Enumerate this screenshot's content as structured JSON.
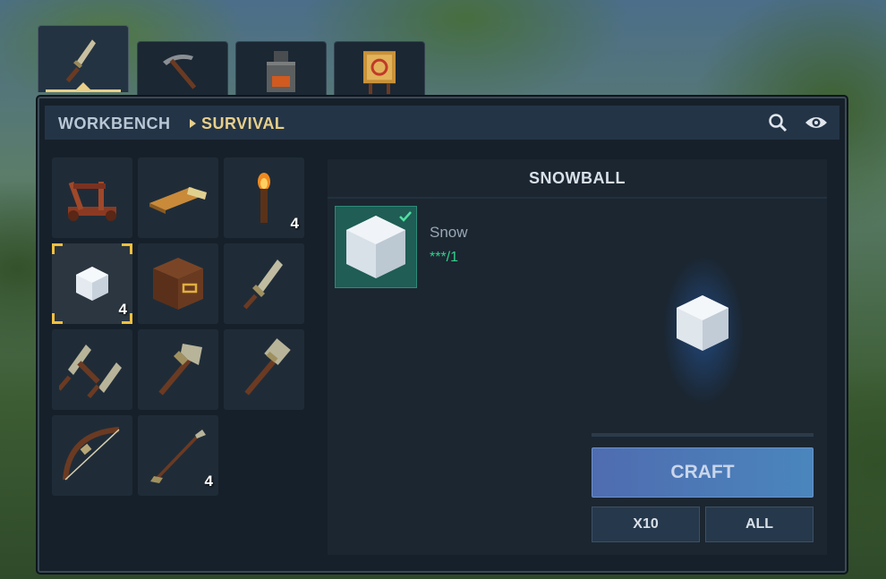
{
  "tabs": [
    {
      "icon": "dagger-icon"
    },
    {
      "icon": "pickaxe-icon"
    },
    {
      "icon": "furnace-icon"
    },
    {
      "icon": "target-icon"
    }
  ],
  "header": {
    "workbench": "WORKBENCH",
    "category": "SURVIVAL",
    "search_icon": "search-icon",
    "view_icon": "eye-icon"
  },
  "recipes": [
    {
      "icon": "catapult-icon",
      "count": ""
    },
    {
      "icon": "bedroll-icon",
      "count": ""
    },
    {
      "icon": "torch-icon",
      "count": "4"
    },
    {
      "icon": "snow-block-icon",
      "count": "4",
      "selected": true
    },
    {
      "icon": "storage-chest-icon",
      "count": ""
    },
    {
      "icon": "stone-dagger-icon",
      "count": ""
    },
    {
      "icon": "dual-daggers-icon",
      "count": ""
    },
    {
      "icon": "stone-axe-icon",
      "count": ""
    },
    {
      "icon": "stone-hammer-icon",
      "count": ""
    },
    {
      "icon": "bow-icon",
      "count": ""
    },
    {
      "icon": "arrow-icon",
      "count": "4"
    }
  ],
  "detail": {
    "title": "SNOWBALL",
    "ingredient": {
      "name": "Snow",
      "qty": "***/1",
      "icon": "snow-block-icon"
    },
    "craft_label": "CRAFT",
    "x10_label": "X10",
    "all_label": "ALL"
  },
  "colors": {
    "accent": "#e8cf8a",
    "selection": "#f0c040",
    "ok": "#35d08a",
    "craft": "#4f6cb0"
  }
}
